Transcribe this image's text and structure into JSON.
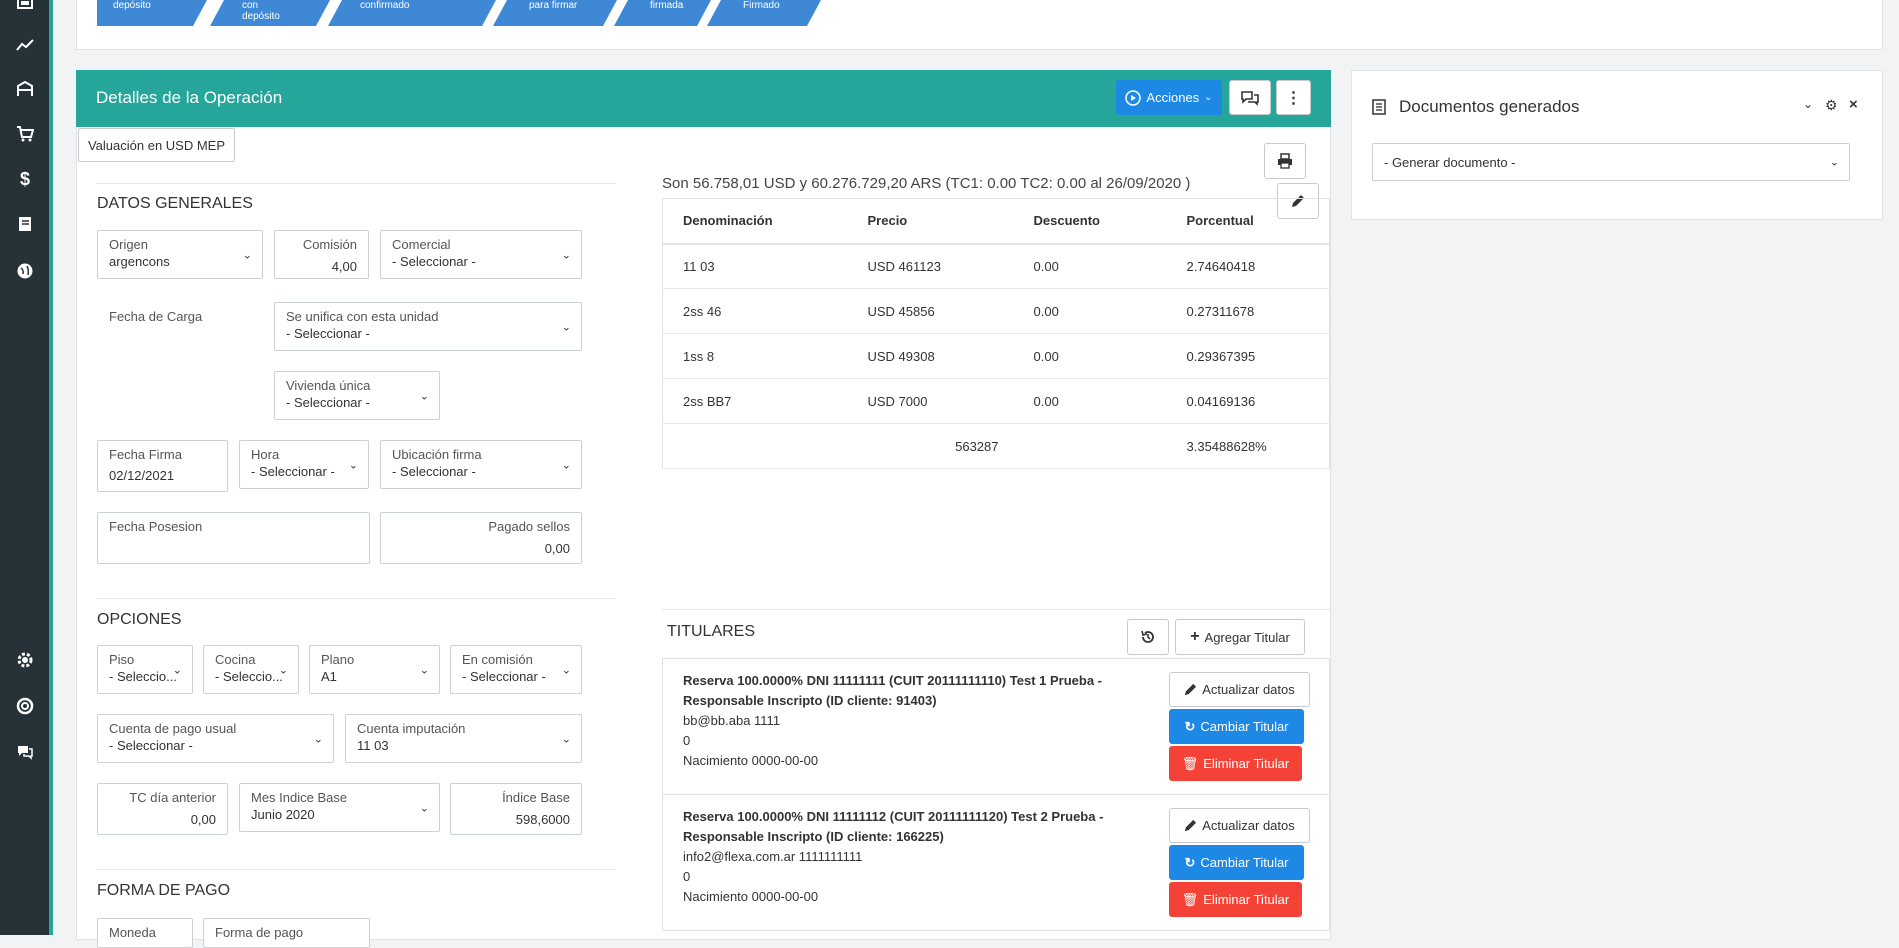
{
  "steps": [
    {
      "label": "depósito"
    },
    {
      "label": "con depósito"
    },
    {
      "label": "confirmado"
    },
    {
      "label": "para firmar"
    },
    {
      "label": "firmada"
    },
    {
      "label": "Firmado"
    }
  ],
  "header": {
    "title": "Detalles de la Operación",
    "acciones_label": "Acciones",
    "valuacion_label": "Valuación en USD MEP"
  },
  "datos_generales": {
    "title": "DATOS GENERALES",
    "origen": {
      "label": "Origen",
      "value": "argencons"
    },
    "comision": {
      "label": "Comisión",
      "value": "4,00"
    },
    "comercial": {
      "label": "Comercial",
      "value": "- Seleccionar -"
    },
    "fecha_carga": {
      "label": "Fecha de Carga"
    },
    "unifica": {
      "label": "Se unifica con esta unidad",
      "value": "- Seleccionar -"
    },
    "vivienda": {
      "label": "Vivienda única",
      "value": "- Seleccionar -"
    },
    "fecha_firma": {
      "label": "Fecha Firma",
      "value": "02/12/2021"
    },
    "hora": {
      "label": "Hora",
      "value": "- Seleccionar -"
    },
    "ubicacion": {
      "label": "Ubicación firma",
      "value": "- Seleccionar -"
    },
    "fecha_posesion": {
      "label": "Fecha Posesion",
      "value": ""
    },
    "pagado_sellos": {
      "label": "Pagado sellos",
      "value": "0,00"
    }
  },
  "opciones": {
    "title": "OPCIONES",
    "piso": {
      "label": "Piso",
      "value": "- Seleccio..."
    },
    "cocina": {
      "label": "Cocina",
      "value": "- Seleccio..."
    },
    "plano": {
      "label": "Plano",
      "value": "A1"
    },
    "en_comision": {
      "label": "En comisión",
      "value": "- Seleccionar -"
    },
    "cuenta_pago": {
      "label": "Cuenta de pago usual",
      "value": "- Seleccionar -"
    },
    "cuenta_imputacion": {
      "label": "Cuenta imputación",
      "value": "11 03"
    },
    "tc_dia": {
      "label": "TC día anterior",
      "value": "0,00"
    },
    "mes_indice": {
      "label": "Mes Indice Base",
      "value": "Junio 2020"
    },
    "indice_base": {
      "label": "Índice Base",
      "value": "598,6000"
    }
  },
  "forma_pago": {
    "title": "FORMA DE PAGO",
    "moneda": {
      "label": "Moneda"
    },
    "forma": {
      "label": "Forma de pago"
    }
  },
  "summary_text": "Son 56.758,01 USD y 60.276.729,20 ARS (TC1: 0.00 TC2: 0.00 al 26/09/2020 )",
  "items_table": {
    "headers": [
      "Denominación",
      "Precio",
      "Descuento",
      "Porcentual"
    ],
    "rows": [
      [
        "11 03",
        "USD 461123",
        "0.00",
        "2.74640418"
      ],
      [
        "2ss 46",
        "USD 45856",
        "0.00",
        "0.27311678"
      ],
      [
        "1ss 8",
        "USD 49308",
        "0.00",
        "0.29367395"
      ],
      [
        "2ss BB7",
        "USD 7000",
        "0.00",
        "0.04169136"
      ]
    ],
    "total_price": "563287",
    "total_pct": "3.35488628%"
  },
  "titulares": {
    "title": "TITULARES",
    "agregar_label": "Agregar Titular",
    "actualizar_label": "Actualizar datos",
    "cambiar_label": "Cambiar Titular",
    "eliminar_label": "Eliminar Titular",
    "items": [
      {
        "line1": "Reserva 100.0000% DNI 11111111 (CUIT 20111111110) Test 1 Prueba -",
        "line2": "Responsable Inscripto (ID cliente: 91403)",
        "line3": "bb@bb.aba 1111",
        "line4": "0",
        "line5": "Nacimiento 0000-00-00"
      },
      {
        "line1": "Reserva 100.0000% DNI 11111112 (CUIT 20111111120) Test 2 Prueba -",
        "line2": "Responsable Inscripto (ID cliente: 166225)",
        "line3": "info2@flexa.com.ar 1111111111",
        "line4": "0",
        "line5": "Nacimiento 0000-00-00"
      }
    ]
  },
  "documentos": {
    "title": "Documentos generados",
    "select_value": "- Generar documento -"
  }
}
